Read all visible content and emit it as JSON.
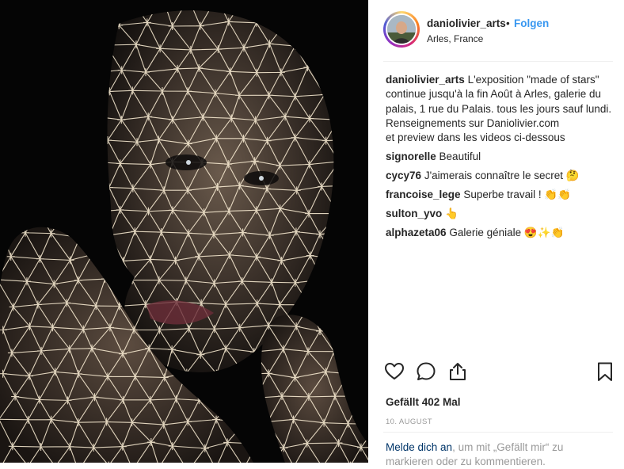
{
  "post": {
    "username": "daniolivier_arts",
    "separator": "•",
    "follow_label": "Folgen",
    "location": "Arles, France",
    "caption_user": "daniolivier_arts",
    "caption_text": "L'exposition \"made of stars\" continue jusqu'à la fin Août à Arles, galerie du palais, 1 rue du Palais. tous les jours sauf lundi.",
    "caption_line2": "Renseignements sur Daniolivier.com",
    "caption_line3": "et preview dans les videos ci-dessous"
  },
  "comments": [
    {
      "user": "signorelle",
      "text": "Beautiful"
    },
    {
      "user": "cycy76",
      "text": "J'aimerais connaître le secret 🤔"
    },
    {
      "user": "francoise_lege",
      "text": "Superbe travail ! 👏👏"
    },
    {
      "user": "sulton_yvo",
      "text": "👆"
    },
    {
      "user": "alphazeta06",
      "text": "Galerie géniale 😍✨👏"
    }
  ],
  "actions": {
    "like_icon": "heart-icon",
    "comment_icon": "comment-icon",
    "share_icon": "share-icon",
    "save_icon": "bookmark-icon"
  },
  "likes_text": "Gefällt 402 Mal",
  "date_text": "10. AUGUST",
  "login": {
    "link_text": "Melde dich an",
    "rest_text": ", um mit „Gefällt mir“ zu markieren oder zu kommentieren."
  },
  "colors": {
    "follow": "#3897f0",
    "photo_background": "#050505",
    "projection_light": "#fff2d8"
  }
}
